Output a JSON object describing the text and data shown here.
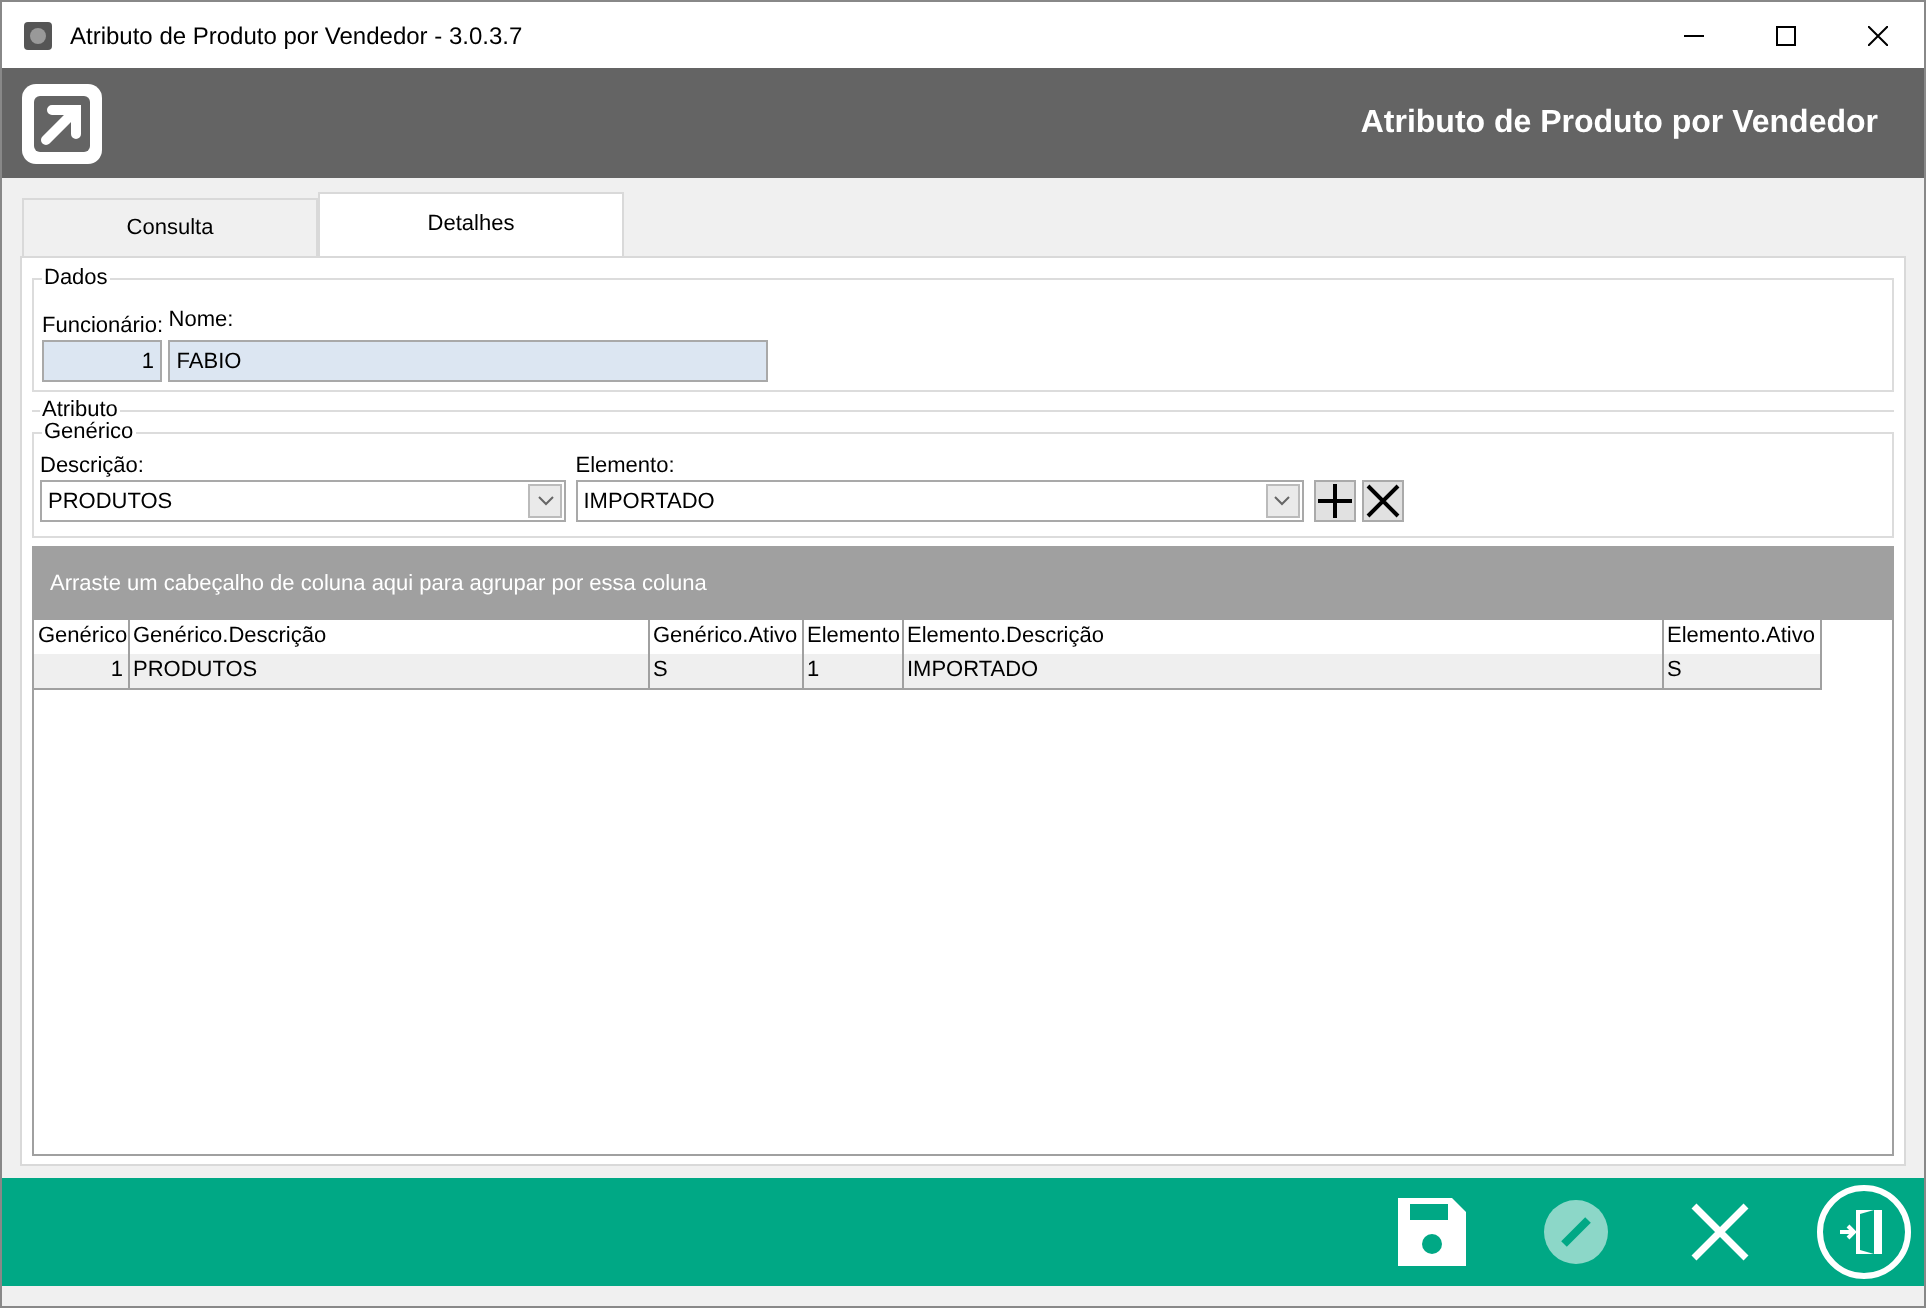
{
  "window": {
    "title": "Atributo de Produto por Vendedor - 3.0.3.7"
  },
  "header": {
    "title": "Atributo de Produto por Vendedor"
  },
  "tabs": [
    {
      "label": "Consulta",
      "selected": false
    },
    {
      "label": "Detalhes",
      "selected": true
    }
  ],
  "dados": {
    "legend": "Dados",
    "funcionario": {
      "label": "Funcionário:",
      "value": "1"
    },
    "nome": {
      "label": "Nome:",
      "value": "FABIO"
    }
  },
  "atributo": {
    "legend": "Atributo",
    "generico": {
      "legend": "Genérico",
      "descricao": {
        "label": "Descrição:",
        "value": "PRODUTOS"
      },
      "elemento": {
        "label": "Elemento:",
        "value": "IMPORTADO"
      }
    }
  },
  "grid": {
    "group_hint": "Arraste um cabeçalho de coluna aqui para agrupar por essa coluna",
    "columns": [
      {
        "label": "Genérico"
      },
      {
        "label": "Genérico.Descrição"
      },
      {
        "label": "Genérico.Ativo"
      },
      {
        "label": "Elemento"
      },
      {
        "label": "Elemento.Descrição"
      },
      {
        "label": "Elemento.Ativo"
      }
    ],
    "rows": [
      {
        "cells": [
          "1",
          "PRODUTOS",
          "S",
          "1",
          "IMPORTADO",
          "S"
        ],
        "selected": true
      }
    ]
  },
  "footer": {
    "buttons": [
      {
        "kind": "save",
        "disabled": false
      },
      {
        "kind": "edit",
        "disabled": true
      },
      {
        "kind": "cancel",
        "disabled": false
      },
      {
        "kind": "exit",
        "disabled": false
      }
    ]
  }
}
